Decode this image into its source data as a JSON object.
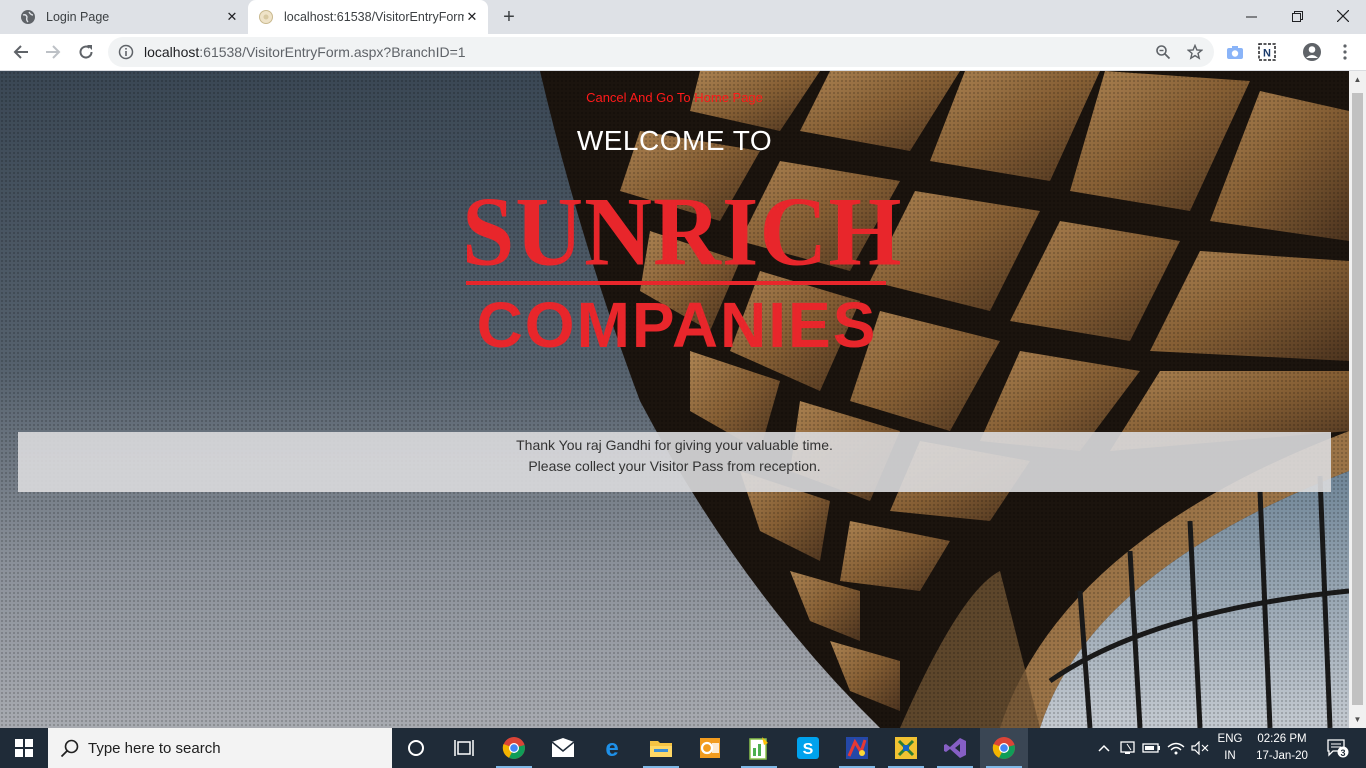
{
  "browser": {
    "tabs": [
      {
        "title": "Login Page",
        "favicon": "globe-icon",
        "active": false
      },
      {
        "title": "localhost:61538/VisitorEntryForm",
        "favicon": "page-icon",
        "active": true
      }
    ],
    "address": {
      "host": "localhost",
      "rest": ":61538/VisitorEntryForm.aspx?BranchID=1"
    }
  },
  "page": {
    "cancel_link": "Cancel And Go To Home Page",
    "welcome": "WELCOME TO",
    "logo_line1": "SUNRICH",
    "logo_line2": "COMPANIES",
    "message_line1": "Thank You raj Gandhi for giving your valuable time.",
    "message_line2": "Please collect your Visitor Pass from reception.",
    "accent_color": "#e8262b",
    "link_color": "#ff1a1a"
  },
  "taskbar": {
    "search_placeholder": "Type here to search",
    "apps": [
      "chrome-icon",
      "mail-icon",
      "edge-icon",
      "file-explorer-icon",
      "outlook-icon",
      "task-app-icon",
      "skype-icon",
      "paint-app-icon",
      "tool-app-icon",
      "visual-studio-icon",
      "chrome-icon"
    ],
    "lang_top": "ENG",
    "lang_bottom": "IN",
    "time": "02:26 PM",
    "date": "17-Jan-20",
    "notification_count": "3"
  }
}
